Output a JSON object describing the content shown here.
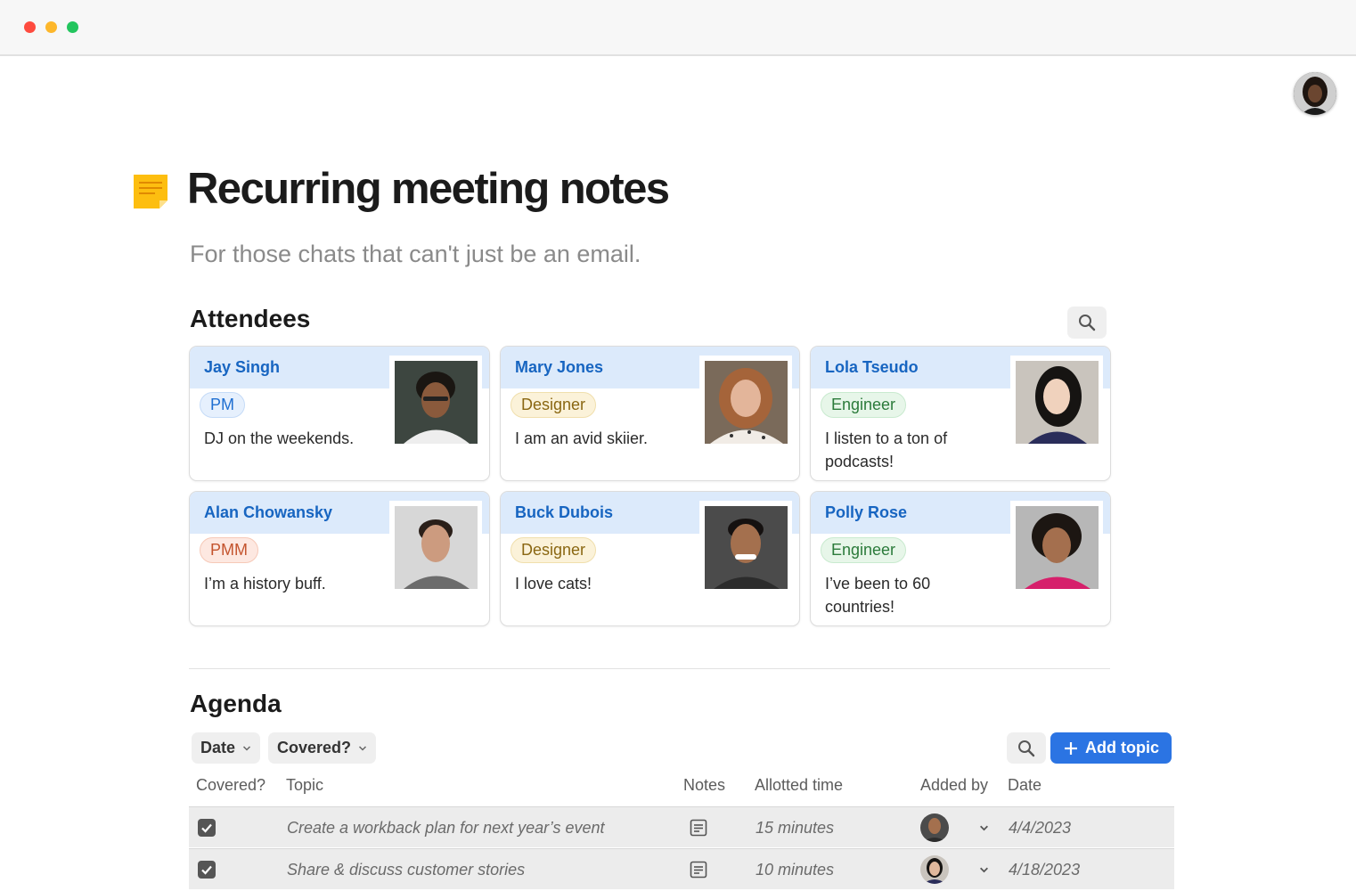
{
  "window": {
    "controls": [
      "close",
      "minimize",
      "maximize"
    ]
  },
  "page": {
    "icon": "sticky-note-icon",
    "title": "Recurring meeting notes",
    "subtitle": "For those chats that can't just be an email."
  },
  "attendees": {
    "title": "Attendees",
    "people": [
      {
        "name": "Jay Singh",
        "role": "PM",
        "note": "DJ on the weekends.",
        "role_color": "blue"
      },
      {
        "name": "Mary Jones",
        "role": "Designer",
        "note": "I am an avid skiier.",
        "role_color": "yellow"
      },
      {
        "name": "Lola Tseudo",
        "role": "Engineer",
        "note": "I listen to a ton of podcasts!",
        "role_color": "green"
      },
      {
        "name": "Alan Chowansky",
        "role": "PMM",
        "note": "I’m a history buff.",
        "role_color": "orange"
      },
      {
        "name": "Buck Dubois",
        "role": "Designer",
        "note": "I love cats!",
        "role_color": "yellow"
      },
      {
        "name": "Polly Rose",
        "role": "Engineer",
        "note": "I’ve been to 60 countries!",
        "role_color": "green"
      }
    ]
  },
  "agenda": {
    "title": "Agenda",
    "filters": [
      "Date",
      "Covered?"
    ],
    "add_label": "Add topic",
    "columns": [
      "Covered?",
      "Topic",
      "Notes",
      "Allotted time",
      "Added by",
      "Date"
    ],
    "rows": [
      {
        "covered": true,
        "topic": "Create a workback plan for next year’s event",
        "time": "15 minutes",
        "date": "4/4/2023"
      },
      {
        "covered": true,
        "topic": "Share & discuss customer stories",
        "time": "10 minutes",
        "date": "4/18/2023"
      }
    ]
  },
  "colors": {
    "accent": "#2b74e3",
    "card_header": "#dceafb",
    "name_text": "#1765c1"
  }
}
